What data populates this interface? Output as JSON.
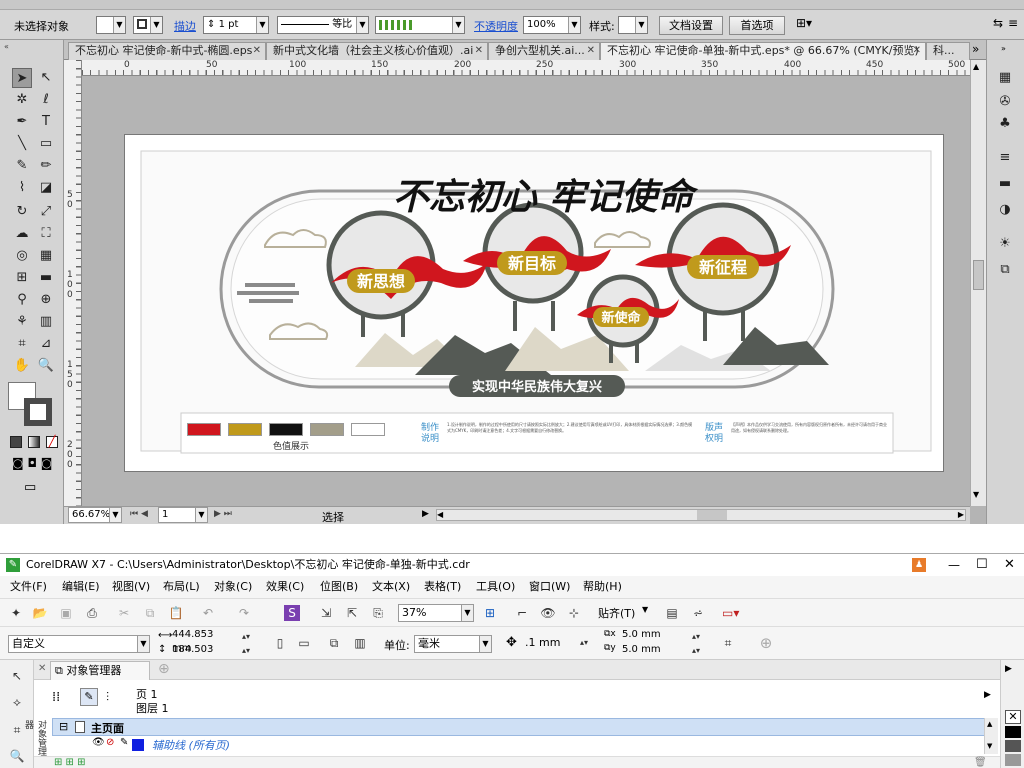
{
  "illustrator": {
    "control_bar": {
      "selection_label": "未选择对象",
      "stroke_label": "描边",
      "stroke_value": "1 pt",
      "profile_label": "等比",
      "opacity_label": "不透明度",
      "opacity_value": "100%",
      "style_label": "样式:",
      "doc_setup_label": "文档设置",
      "prefs_label": "首选项"
    },
    "tabs": [
      {
        "label": "不忘初心 牢记使命-新中式-椭圆.eps"
      },
      {
        "label": "新中式文化墙（社会主义核心价值观）.ai"
      },
      {
        "label": "争创六型机关.ai..."
      },
      {
        "label": "不忘初心 牢记使命-单独-新中式.eps* @ 66.67% (CMYK/预览)"
      },
      {
        "label": "科..."
      }
    ],
    "tabs_more": "»",
    "ruler_h": [
      "0",
      "50",
      "100",
      "150",
      "200",
      "250",
      "300",
      "350",
      "400",
      "450",
      "500"
    ],
    "ruler_v": [
      "5",
      "0",
      "1",
      "0",
      "0",
      "1",
      "5",
      "0",
      "2",
      "0",
      "0"
    ],
    "status": {
      "zoom": "66.67%",
      "page": "1",
      "mode": "选择"
    },
    "artwork": {
      "title": "不忘初心 牢记使命",
      "circles": [
        "新思想",
        "新目标",
        "新使命",
        "新征程"
      ],
      "banner": "实现中华民族伟大复兴",
      "palette_label": "色值展示",
      "palette_colors": [
        "#d0161e",
        "#c09a1c",
        "#111111",
        "#a39e8a",
        "#ffffff"
      ],
      "notes_title_line1": "制作",
      "notes_title_line2": "说明",
      "notes_text": "1.设计制作说明，制作的过程中所使用的尺寸请按照实际比例放大；2.建议使用写真喷绘或UV打印，具体材质根据实际情况选择；3.颜色模式为CMYK，印刷时请注意色差；4.文字可根据需要自行修改替换。",
      "copyright_title_line1": "版声",
      "copyright_title_line2": "权明",
      "copyright_text": "【声明】本作品仅供学习交流使用，所有内容版权归原作者所有，未经许可请勿用于商业用途，如有侵权请联系删除处理。"
    },
    "colors": {
      "red": "#d0161e",
      "gold": "#c09a1c",
      "gray": "#555a55",
      "light": "#d8d4c8"
    }
  },
  "coreldraw": {
    "title": "CorelDRAW X7 - C:\\Users\\Administrator\\Desktop\\不忘初心 牢记使命-单独-新中式.cdr",
    "menu": [
      "文件(F)",
      "编辑(E)",
      "视图(V)",
      "布局(L)",
      "对象(C)",
      "效果(C)",
      "位图(B)",
      "文本(X)",
      "表格(T)",
      "工具(O)",
      "窗口(W)",
      "帮助(H)"
    ],
    "toolbar": {
      "zoom": "37%",
      "snap_label": "贴齐(T)",
      "page_size": "自定义",
      "width": "444.853 mm",
      "height": "184.503 mm",
      "unit_label": "单位:",
      "unit_value": "毫米",
      "nudge": ".1 mm",
      "dup_x": "5.0 mm",
      "dup_y": "5.0 mm"
    },
    "object_manager": {
      "tab_label": "对象管理器",
      "page_label": "页 1",
      "layer_label": "图层 1",
      "main_page": "主页面",
      "guides_layer": "辅助线 (所有页)",
      "side_label": "对象管理器"
    },
    "window_controls": {
      "minimize": "—",
      "maximize": "☐",
      "close": "✕"
    }
  }
}
